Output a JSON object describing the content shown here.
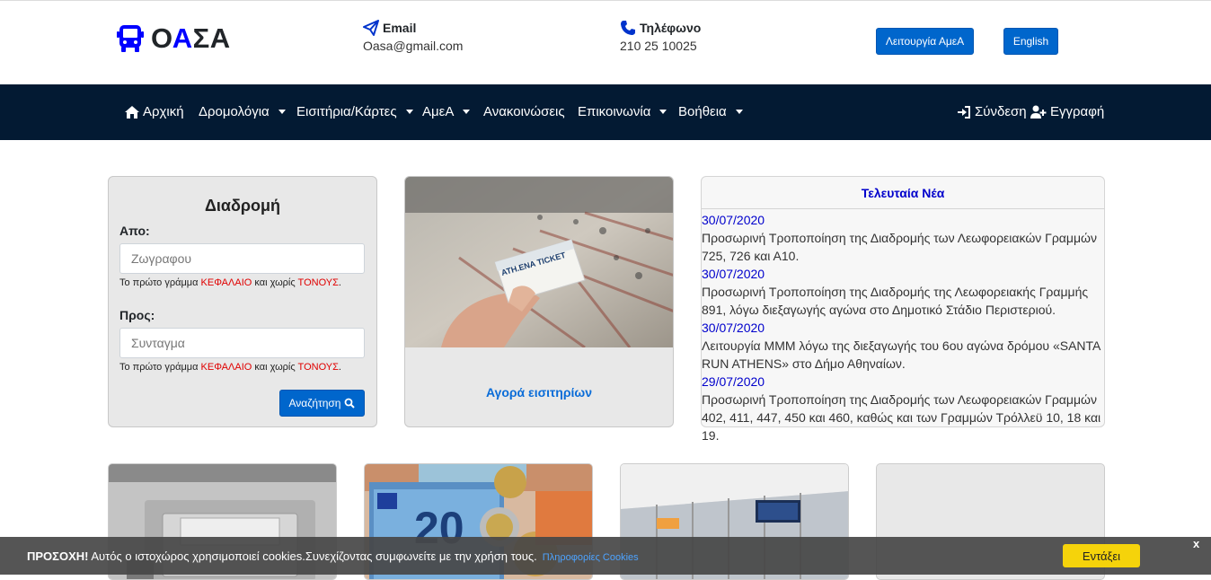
{
  "header": {
    "logo": {
      "prefix": "Ο",
      "accent": "Α",
      "suffix": "ΣΑ"
    },
    "email": {
      "label": "Email",
      "value": "Oasa@gmail.com"
    },
    "phone": {
      "label": "Τηλέφωνο",
      "value": "210 25 10025"
    },
    "accessibility_button": "Λειτουργία ΑμεΑ",
    "language_button": "English"
  },
  "nav": {
    "items": [
      {
        "label": "Αρχική",
        "icon": "home-icon"
      },
      {
        "label": "Δρομολόγια",
        "dropdown": true
      },
      {
        "label": "Εισιτήρια/Κάρτες",
        "dropdown": true
      },
      {
        "label": "ΑμεΑ",
        "dropdown": true
      },
      {
        "label": "Ανακοινώσεις"
      },
      {
        "label": "Επικοινωνία",
        "dropdown": true
      },
      {
        "label": "Βοήθεια",
        "dropdown": true
      }
    ],
    "login": "Σύνδεση",
    "register": "Εγγραφή"
  },
  "route": {
    "title": "Διαδρομή",
    "from_label": "Απο:",
    "from_placeholder": "Ζωγραφου",
    "to_label": "Προς:",
    "to_placeholder": "Συνταγμα",
    "hint_pre": "Το πρώτο γράμμα ",
    "hint_caps": "ΚΕΦΑΛΑΙΟ",
    "hint_mid": " και χωρίς ",
    "hint_accents": "ΤΟΝΟΥΣ",
    "hint_end": ".",
    "search_button": "Αναζήτηση"
  },
  "ticket": {
    "card_text": "ATH.ENA TICKET",
    "link": "Αγορά εισιτηρίων"
  },
  "news": {
    "title": "Τελευταία Νέα",
    "items": [
      {
        "date": "30/07/2020",
        "text": "Προσωρινή Τροποποίηση της Διαδρομής των Λεωφορειακών Γραμμών 725, 726 και Α10."
      },
      {
        "date": "30/07/2020",
        "text": "Προσωρινή Τροποποίηση της Διαδρομής της Λεωφορειακής Γραμμής 891, λόγω διεξαγωγής αγώνα στο Δημοτικό Στάδιο Περιστεριού."
      },
      {
        "date": "30/07/2020",
        "text": "Λειτουργία ΜΜΜ λόγω της διεξαγωγής του 6ου αγώνα δρόμου «SANTA RUN ATHENS» στο Δήμο Αθηναίων."
      },
      {
        "date": "29/07/2020",
        "text": "Προσωρινή Τροποποίηση της Διαδρομής των Λεωφορειακών Γραμμών 402, 411, 447, 450 και 460, καθώς και των Γραμμών Τρόλλεϋ 10, 18 και 19."
      }
    ]
  },
  "bottom": {
    "banknote_value": "20"
  },
  "cookie": {
    "warning": "ΠΡΟΣΟΧΗ!",
    "text": " Αυτός ο ιστοχώρος χρησιμοποιεί cookies.Συνεχίζοντας συμφωνείτε με την χρήση τους.",
    "link": "Πληροφορίες Cookies",
    "ok": "Εντάξει",
    "close": "x"
  }
}
